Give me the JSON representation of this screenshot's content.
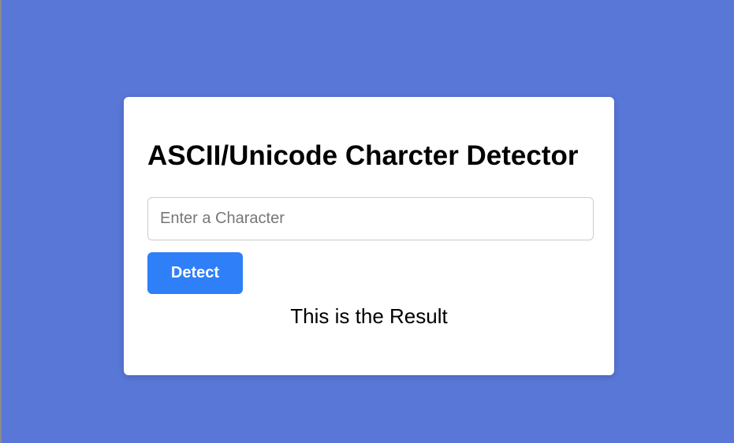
{
  "colors": {
    "background": "#5977d7",
    "card": "#ffffff",
    "accent": "#2f7ff8"
  },
  "card": {
    "title": "ASCII/Unicode Charcter Detector",
    "input": {
      "value": "",
      "placeholder": "Enter a Character"
    },
    "detect_label": "Detect",
    "result_text": "This is the Result"
  }
}
